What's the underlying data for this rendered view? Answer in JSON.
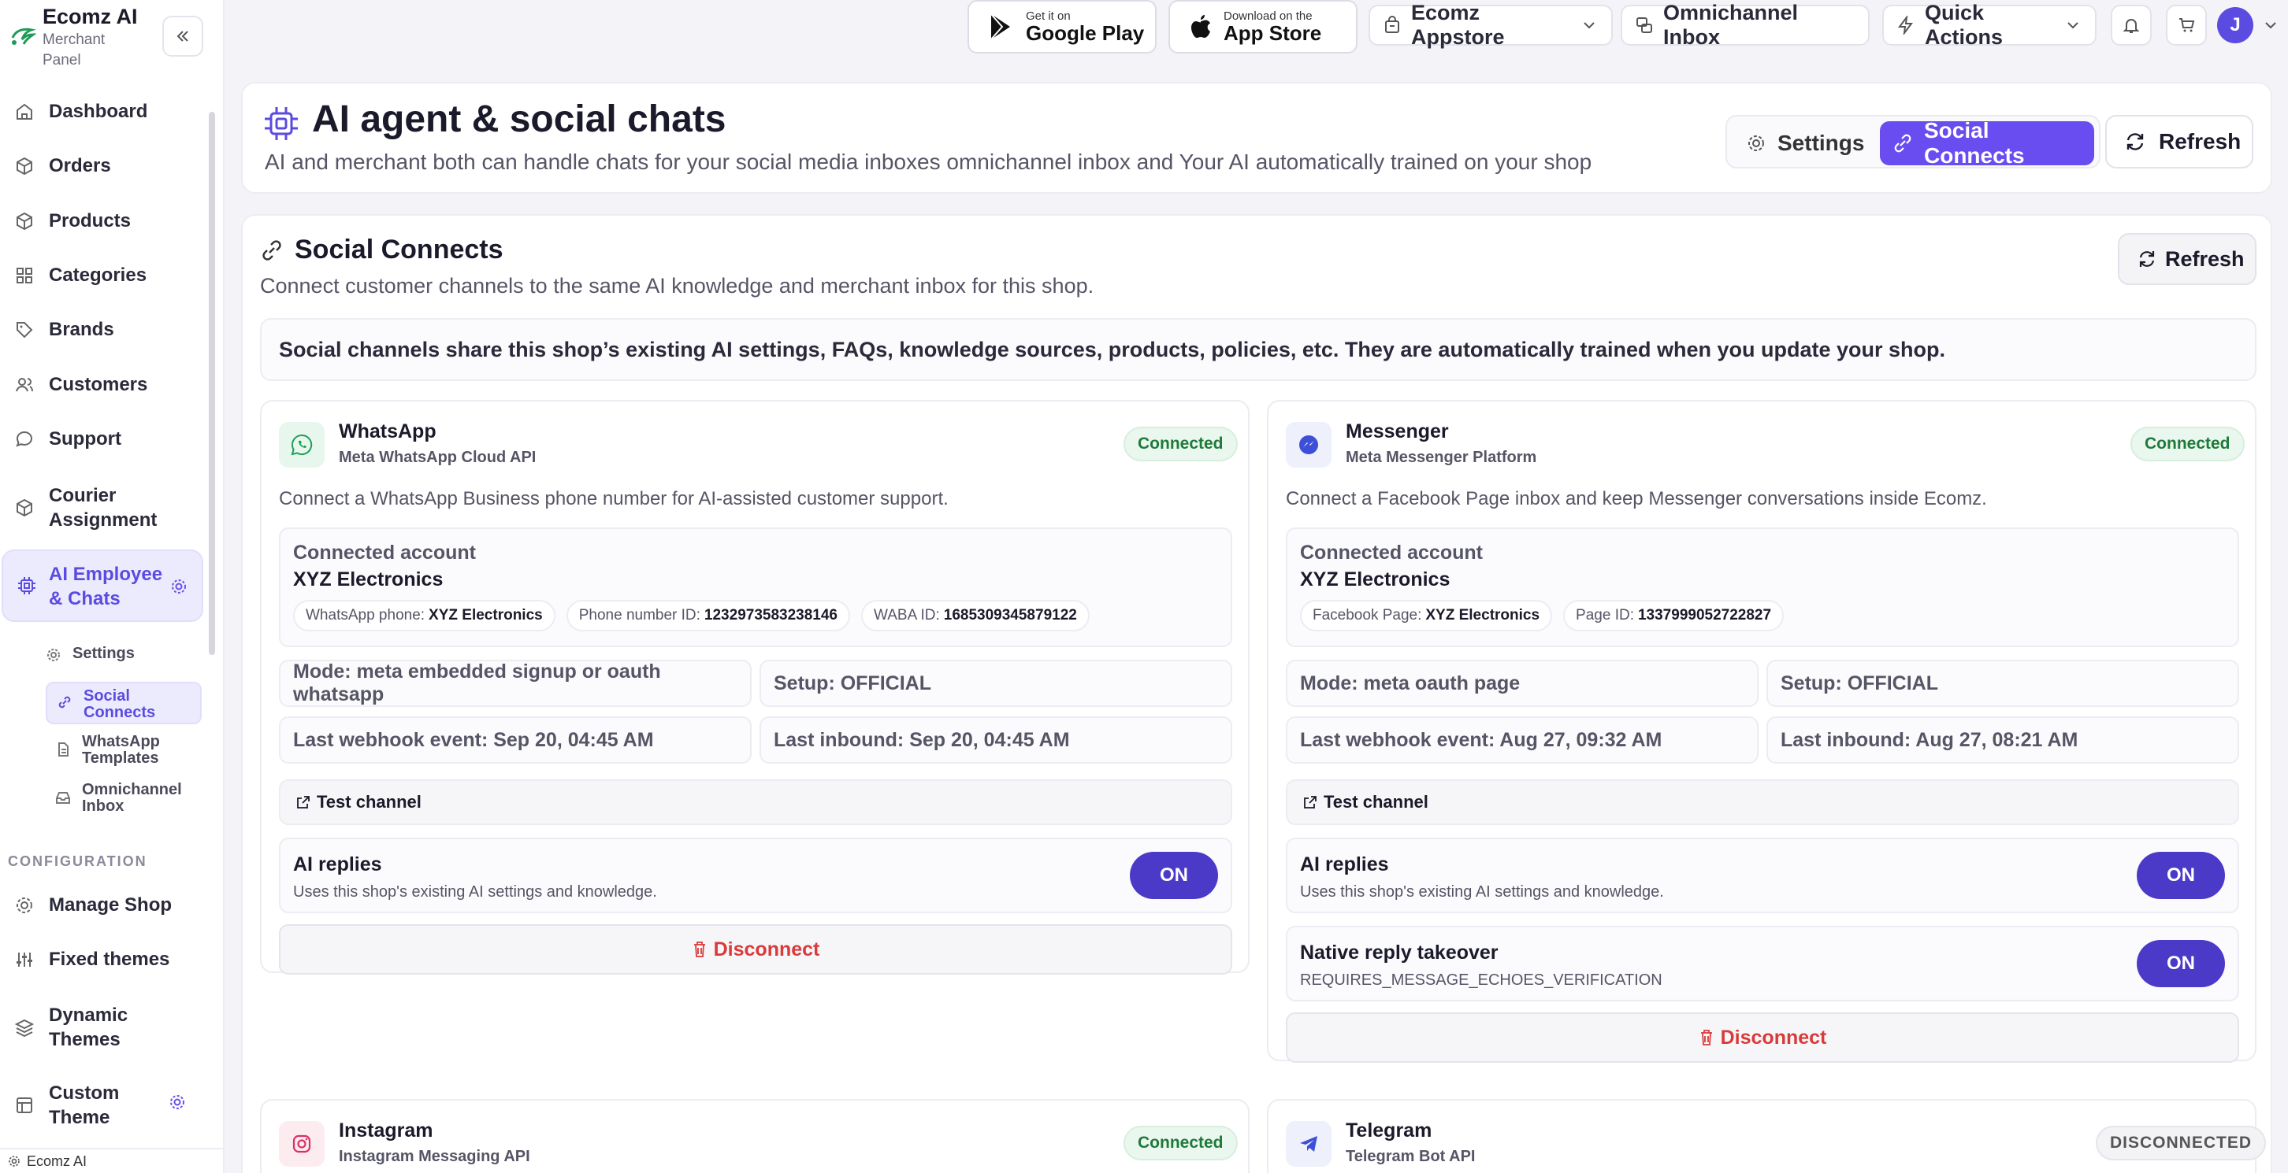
{
  "sidebar": {
    "brand_title": "Ecomz AI",
    "brand_sub_1": "Merchant",
    "brand_sub_2": "Panel",
    "items": [
      {
        "label": "Dashboard"
      },
      {
        "label": "Orders"
      },
      {
        "label": "Products"
      },
      {
        "label": "Categories"
      },
      {
        "label": "Brands"
      },
      {
        "label": "Customers"
      },
      {
        "label": "Support"
      },
      {
        "label_1": "Courier",
        "label_2": "Assignment"
      },
      {
        "label_1": "AI Employee",
        "label_2": "& Chats"
      }
    ],
    "sub_items": [
      {
        "label_1": "Settings"
      },
      {
        "label_1": "Social",
        "label_2": "Connects"
      },
      {
        "label_1": "WhatsApp",
        "label_2": "Templates"
      },
      {
        "label_1": "Omnichannel",
        "label_2": "Inbox"
      }
    ],
    "section_label": "CONFIGURATION",
    "config_items": [
      {
        "label": "Manage Shop"
      },
      {
        "label": "Fixed themes"
      },
      {
        "label_1": "Dynamic",
        "label_2": "Themes"
      },
      {
        "label_1": "Custom",
        "label_2": "Theme"
      }
    ],
    "footer": "Ecomz AI"
  },
  "topbar": {
    "google_small": "Get it on",
    "google_big": "Google Play",
    "apple_small": "Download on the",
    "apple_big": "App Store",
    "appstore": "Ecomz Appstore",
    "inbox": "Omnichannel Inbox",
    "quick_actions": "Quick Actions",
    "avatar": "J"
  },
  "header": {
    "title": "AI agent & social chats",
    "subtitle": "AI and merchant both can handle chats for your social media inboxes omnichannel inbox and Your AI automatically trained on your shop",
    "tab_settings": "Settings",
    "tab_social": "Social Connects",
    "refresh": "Refresh"
  },
  "social": {
    "title": "Social Connects",
    "subtitle": "Connect customer channels to the same AI knowledge and merchant inbox for this shop.",
    "refresh": "Refresh",
    "notice": "Social channels share this shop’s existing AI settings, FAQs, knowledge sources, products, policies, etc. They are automatically trained when you update your shop."
  },
  "channels": {
    "whatsapp": {
      "name": "WhatsApp",
      "api": "Meta WhatsApp Cloud API",
      "status": "Connected",
      "desc": "Connect a WhatsApp Business phone number for AI-assisted customer support.",
      "acct_label": "Connected account",
      "acct_name": "XYZ Electronics",
      "chip1_k": "WhatsApp phone:",
      "chip1_v": "XYZ Electronics",
      "chip2_k": "Phone number ID:",
      "chip2_v": "1232973583238146",
      "chip3_k": "WABA ID:",
      "chip3_v": "1685309345879122",
      "mode": "Mode: meta embedded signup or oauth whatsapp",
      "setup": "Setup: OFFICIAL",
      "webhook": "Last webhook event: Sep 20, 04:45 AM",
      "inbound": "Last inbound: Sep 20, 04:45 AM",
      "test": "Test channel",
      "ai_title": "AI replies",
      "ai_sub": "Uses this shop's existing AI settings and knowledge.",
      "ai_state": "ON",
      "disconnect": "Disconnect"
    },
    "messenger": {
      "name": "Messenger",
      "api": "Meta Messenger Platform",
      "status": "Connected",
      "desc": "Connect a Facebook Page inbox and keep Messenger conversations inside Ecomz.",
      "acct_label": "Connected account",
      "acct_name": "XYZ Electronics",
      "chip1_k": "Facebook Page:",
      "chip1_v": "XYZ Electronics",
      "chip2_k": "Page ID:",
      "chip2_v": "1337999052722827",
      "mode": "Mode: meta oauth page",
      "setup": "Setup: OFFICIAL",
      "webhook": "Last webhook event: Aug 27, 09:32 AM",
      "inbound": "Last inbound: Aug 27, 08:21 AM",
      "test": "Test channel",
      "ai_title": "AI replies",
      "ai_sub": "Uses this shop's existing AI settings and knowledge.",
      "ai_state": "ON",
      "native_title": "Native reply takeover",
      "native_sub": "REQUIRES_MESSAGE_ECHOES_VERIFICATION",
      "native_state": "ON",
      "disconnect": "Disconnect"
    },
    "instagram": {
      "name": "Instagram",
      "api": "Instagram Messaging API",
      "status": "Connected"
    },
    "telegram": {
      "name": "Telegram",
      "api": "Telegram Bot API",
      "status": "DISCONNECTED"
    }
  },
  "colors": {
    "accent": "#6a4df0",
    "toggle_on": "#4b3ac8",
    "connected": "#1f7a3a",
    "danger": "#d93a3a"
  }
}
